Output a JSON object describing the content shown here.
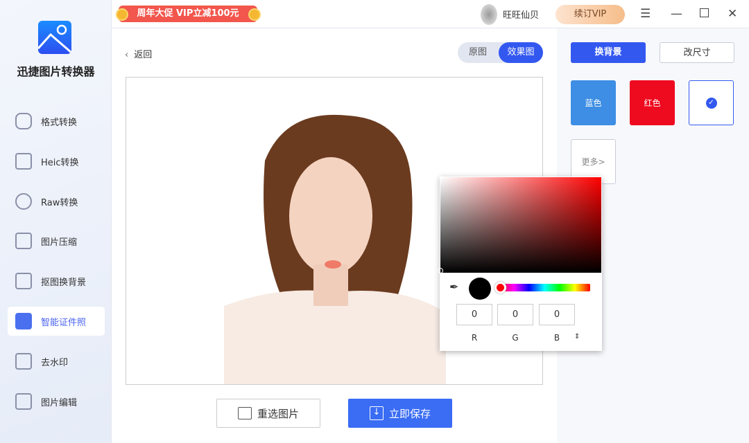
{
  "app": {
    "name": "迅捷图片转换器"
  },
  "sidebar": {
    "items": [
      {
        "label": "格式转换",
        "icon": "format-convert-icon"
      },
      {
        "label": "Heic转换",
        "icon": "heic-icon"
      },
      {
        "label": "Raw转换",
        "icon": "raw-icon"
      },
      {
        "label": "图片压缩",
        "icon": "compress-icon"
      },
      {
        "label": "抠图换背景",
        "icon": "cutout-icon"
      },
      {
        "label": "智能证件照",
        "icon": "id-photo-icon",
        "active": true
      },
      {
        "label": "去水印",
        "icon": "watermark-icon"
      },
      {
        "label": "图片编辑",
        "icon": "image-edit-icon"
      }
    ]
  },
  "topbar": {
    "promo": "周年大促 VIP立减100元",
    "username": "旺旺仙贝",
    "vip_button": "续订VIP"
  },
  "main": {
    "back": "返回",
    "toggle": {
      "original": "原图",
      "effect": "效果图",
      "selected": "效果图"
    },
    "reselect": "重选图片",
    "save": "立即保存"
  },
  "panel": {
    "tabs": [
      "换背景",
      "改尺寸"
    ],
    "swatches": [
      {
        "label": "蓝色",
        "color": "#3d8ee4"
      },
      {
        "label": "红色",
        "color": "#ee0a1f"
      }
    ],
    "more": "更多>"
  },
  "picker": {
    "r": "0",
    "g": "0",
    "b": "0",
    "r_label": "R",
    "g_label": "G",
    "b_label": "B",
    "color": "#000000",
    "hue_color": "#ff0000"
  },
  "colors": {
    "accent": "#3358f0"
  }
}
